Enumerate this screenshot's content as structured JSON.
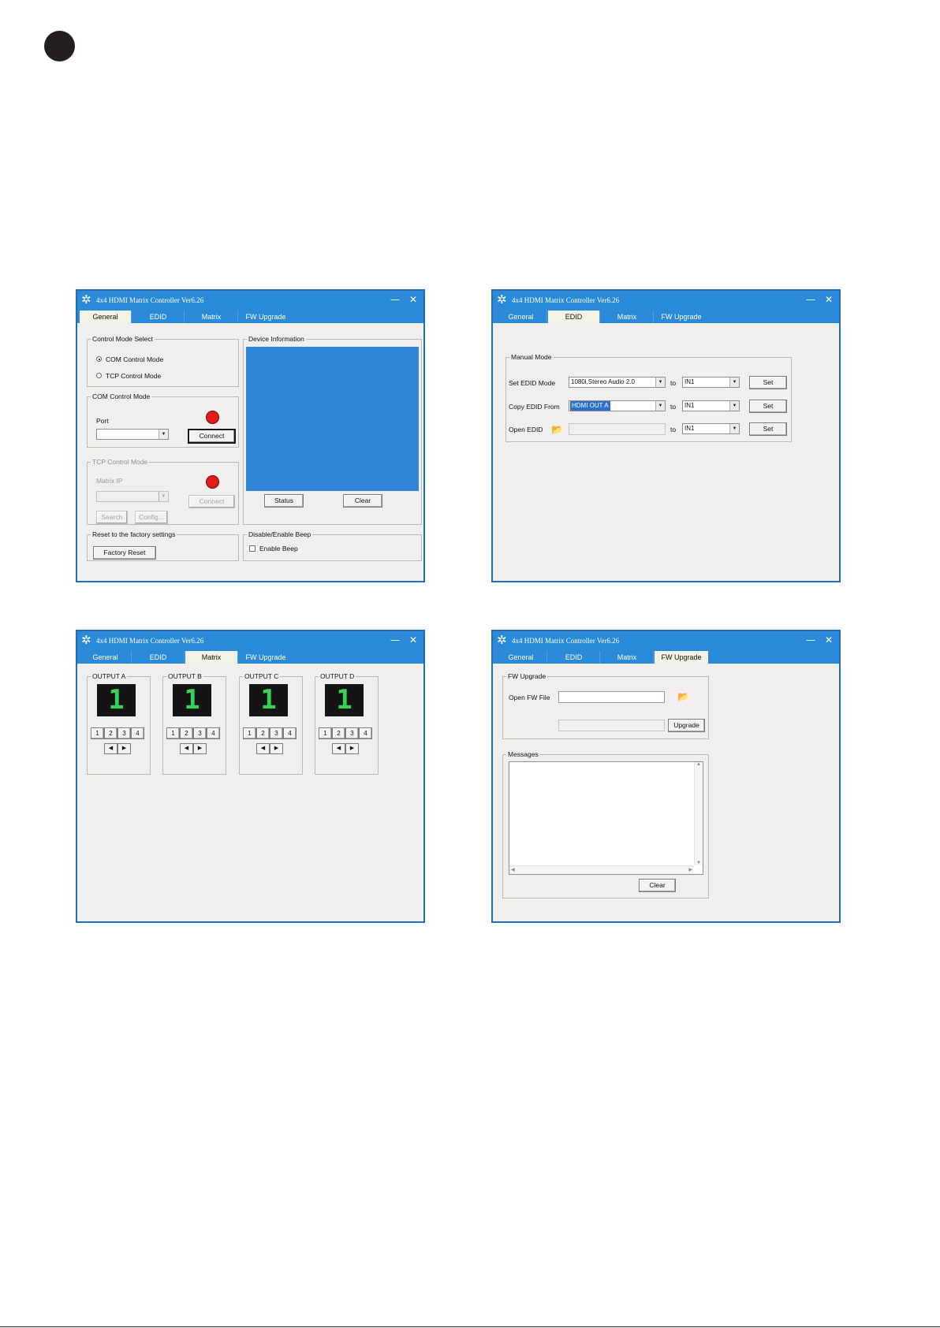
{
  "window_title": "4x4 HDMI Matrix Controller Ver6.26",
  "window_controls": {
    "minimize": "—",
    "close": "✕"
  },
  "tabs": [
    "General",
    "EDID",
    "Matrix",
    "FW Upgrade"
  ],
  "icons": {
    "app": "gear-icon",
    "folder": "folder-open-icon"
  },
  "colors": {
    "title_bar": "#2b8ad8",
    "active_tab": "#f3f2e6",
    "device_info": "#2f86d4",
    "led_off": "#e31b1b",
    "segment_digit": "#34d25a"
  },
  "general": {
    "control_mode_select": {
      "legend": "Control Mode Select",
      "com_label": "COM Control Mode",
      "tcp_label": "TCP Control Mode",
      "selected": "COM Control Mode"
    },
    "com_mode": {
      "legend": "COM Control Mode",
      "port_label": "Port",
      "port_value": "",
      "connect": "Connect"
    },
    "tcp_mode": {
      "legend": "TCP Control Mode",
      "ip_label": "Matrix  IP",
      "ip_value": "",
      "connect": "Connect",
      "search": "Search",
      "config": "Config..."
    },
    "device_info": {
      "legend": "Device Information",
      "status": "Status",
      "clear": "Clear"
    },
    "factory": {
      "legend": "Reset to the factory settings",
      "button": "Factory Reset"
    },
    "beep": {
      "legend": "Disable/Enable Beep",
      "label": "Enable Beep",
      "checked": false
    }
  },
  "edid": {
    "legend": "Manual Mode",
    "rows": [
      {
        "label": "Set EDID Mode",
        "source": "1080i,Stereo Audio 2.0",
        "to": "to",
        "target": "IN1",
        "button": "Set"
      },
      {
        "label": "Copy EDID From",
        "source": "HDMI OUT A",
        "to": "to",
        "target": "IN1",
        "button": "Set"
      },
      {
        "label": "Open EDID",
        "source": "",
        "to": "to",
        "target": "IN1",
        "button": "Set"
      }
    ]
  },
  "matrix": {
    "outputs": [
      {
        "label": "OUTPUT A",
        "value": "1"
      },
      {
        "label": "OUTPUT B",
        "value": "1"
      },
      {
        "label": "OUTPUT C",
        "value": "1"
      },
      {
        "label": "OUTPUT D",
        "value": "1"
      }
    ],
    "inputs": [
      "1",
      "2",
      "3",
      "4"
    ],
    "prev": "◀",
    "next": "▶"
  },
  "fw_upgrade": {
    "legend": "FW Upgrade",
    "open_label": "Open FW File",
    "file_value": "",
    "upgrade": "Upgrade",
    "messages_legend": "Messages",
    "clear": "Clear"
  }
}
